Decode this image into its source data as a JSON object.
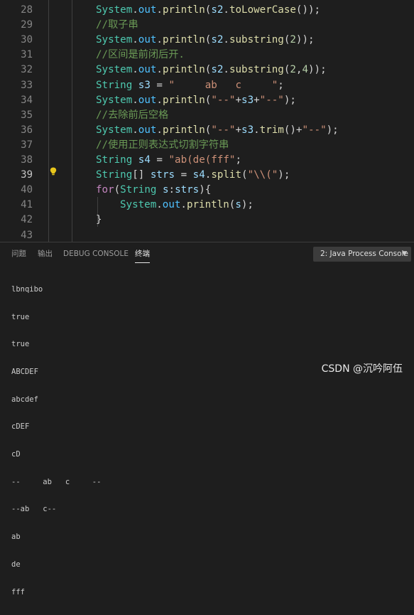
{
  "editor": {
    "lines": [
      {
        "num": "28",
        "tokens": [
          [
            "cls",
            "System"
          ],
          [
            "pun",
            "."
          ],
          [
            "fld",
            "out"
          ],
          [
            "pun",
            "."
          ],
          [
            "fn",
            "println"
          ],
          [
            "pun",
            "("
          ],
          [
            "var",
            "s2"
          ],
          [
            "pun",
            "."
          ],
          [
            "fn",
            "toLowerCase"
          ],
          [
            "pun",
            "());"
          ]
        ]
      },
      {
        "num": "29",
        "tokens": [
          [
            "cmt",
            "//取子串"
          ]
        ]
      },
      {
        "num": "30",
        "tokens": [
          [
            "cls",
            "System"
          ],
          [
            "pun",
            "."
          ],
          [
            "fld",
            "out"
          ],
          [
            "pun",
            "."
          ],
          [
            "fn",
            "println"
          ],
          [
            "pun",
            "("
          ],
          [
            "var",
            "s2"
          ],
          [
            "pun",
            "."
          ],
          [
            "fn",
            "substring"
          ],
          [
            "pun",
            "("
          ],
          [
            "num",
            "2"
          ],
          [
            "pun",
            "));"
          ]
        ]
      },
      {
        "num": "31",
        "tokens": [
          [
            "cmt",
            "//区间是前闭后开."
          ]
        ]
      },
      {
        "num": "32",
        "tokens": [
          [
            "cls",
            "System"
          ],
          [
            "pun",
            "."
          ],
          [
            "fld",
            "out"
          ],
          [
            "pun",
            "."
          ],
          [
            "fn",
            "println"
          ],
          [
            "pun",
            "("
          ],
          [
            "var",
            "s2"
          ],
          [
            "pun",
            "."
          ],
          [
            "fn",
            "substring"
          ],
          [
            "pun",
            "("
          ],
          [
            "num",
            "2"
          ],
          [
            "pun",
            ","
          ],
          [
            "num",
            "4"
          ],
          [
            "pun",
            "));"
          ]
        ]
      },
      {
        "num": "33",
        "tokens": [
          [
            "cls",
            "String"
          ],
          [
            "pun",
            " "
          ],
          [
            "var",
            "s3"
          ],
          [
            "pun",
            " = "
          ],
          [
            "str",
            "\"     ab   c     \""
          ],
          [
            "pun",
            ";"
          ]
        ]
      },
      {
        "num": "34",
        "tokens": [
          [
            "cls",
            "System"
          ],
          [
            "pun",
            "."
          ],
          [
            "fld",
            "out"
          ],
          [
            "pun",
            "."
          ],
          [
            "fn",
            "println"
          ],
          [
            "pun",
            "("
          ],
          [
            "str",
            "\"--\""
          ],
          [
            "pun",
            "+"
          ],
          [
            "var",
            "s3"
          ],
          [
            "pun",
            "+"
          ],
          [
            "str",
            "\"--\""
          ],
          [
            "pun",
            ");"
          ]
        ]
      },
      {
        "num": "35",
        "tokens": [
          [
            "cmt",
            "//去除前后空格"
          ]
        ]
      },
      {
        "num": "36",
        "tokens": [
          [
            "cls",
            "System"
          ],
          [
            "pun",
            "."
          ],
          [
            "fld",
            "out"
          ],
          [
            "pun",
            "."
          ],
          [
            "fn",
            "println"
          ],
          [
            "pun",
            "("
          ],
          [
            "str",
            "\"--\""
          ],
          [
            "pun",
            "+"
          ],
          [
            "var",
            "s3"
          ],
          [
            "pun",
            "."
          ],
          [
            "fn",
            "trim"
          ],
          [
            "pun",
            "()+"
          ],
          [
            "str",
            "\"--\""
          ],
          [
            "pun",
            ");"
          ]
        ]
      },
      {
        "num": "37",
        "tokens": [
          [
            "cmt",
            "//使用正则表达式切割字符串"
          ]
        ]
      },
      {
        "num": "38",
        "tokens": [
          [
            "cls",
            "String"
          ],
          [
            "pun",
            " "
          ],
          [
            "var",
            "s4"
          ],
          [
            "pun",
            " = "
          ],
          [
            "str",
            "\"ab(de(fff\""
          ],
          [
            "pun",
            ";"
          ]
        ]
      },
      {
        "num": "39",
        "tokens": [
          [
            "cls",
            "String"
          ],
          [
            "pun",
            "[] "
          ],
          [
            "var",
            "strs"
          ],
          [
            "pun",
            " = "
          ],
          [
            "var",
            "s4"
          ],
          [
            "pun",
            "."
          ],
          [
            "fn",
            "split"
          ],
          [
            "pun",
            "("
          ],
          [
            "str",
            "\"\\\\(\""
          ],
          [
            "pun",
            ");"
          ]
        ]
      },
      {
        "num": "40",
        "tokens": [
          [
            "kw",
            "for"
          ],
          [
            "pun",
            "("
          ],
          [
            "cls",
            "String"
          ],
          [
            "pun",
            " "
          ],
          [
            "var",
            "s"
          ],
          [
            "pun",
            ":"
          ],
          [
            "var",
            "strs"
          ],
          [
            "pun",
            "){"
          ]
        ]
      },
      {
        "num": "41",
        "indent": true,
        "tokens": [
          [
            "cls",
            "System"
          ],
          [
            "pun",
            "."
          ],
          [
            "fld",
            "out"
          ],
          [
            "pun",
            "."
          ],
          [
            "fn",
            "println"
          ],
          [
            "pun",
            "("
          ],
          [
            "var",
            "s"
          ],
          [
            "pun",
            ");"
          ]
        ]
      },
      {
        "num": "42",
        "tokens": [
          [
            "pun",
            "}"
          ]
        ]
      },
      {
        "num": "43",
        "tokens": []
      }
    ]
  },
  "panel": {
    "tabs": [
      "问题",
      "输出",
      "DEBUG CONSOLE",
      "终端"
    ],
    "active_tab": "终端",
    "console_select": "2: Java Process Console",
    "output": [
      "lbnqibo",
      "true",
      "true",
      "ABCDEF",
      "abcdef",
      "cDEF",
      "cD",
      "--     ab   c     --",
      "--ab   c--",
      "ab",
      "de",
      "fff"
    ]
  },
  "watermark": "CSDN @沉吟阿伍",
  "colors": {
    "background": "#1e1e1e",
    "keyword": "#c586c0",
    "class": "#4ec9b0",
    "string": "#ce9178",
    "comment": "#6a9955",
    "function": "#dcdcaa",
    "variable": "#9cdcfe"
  }
}
